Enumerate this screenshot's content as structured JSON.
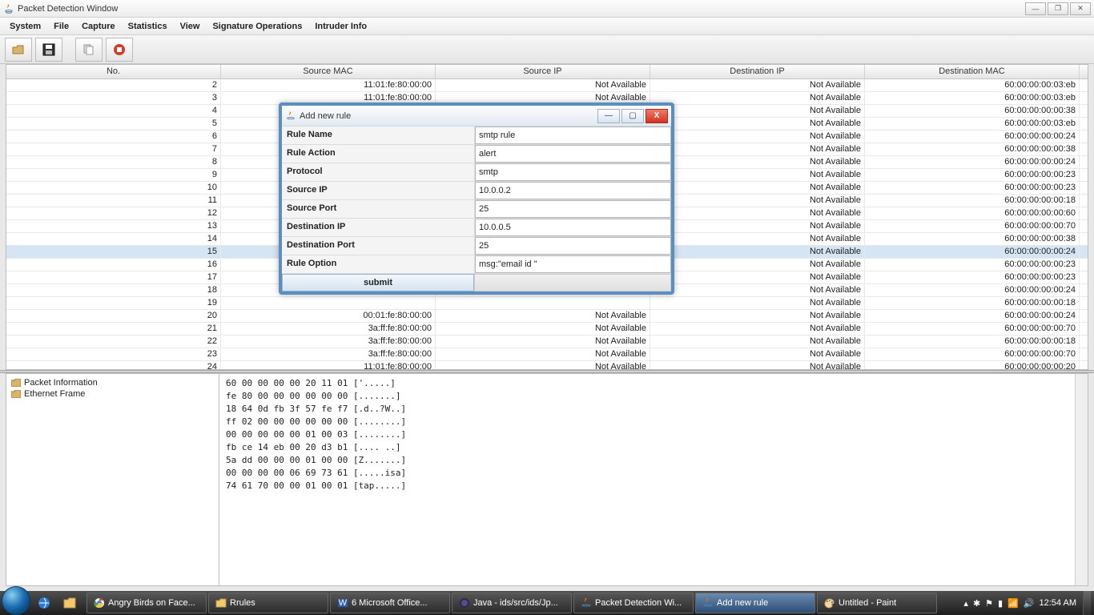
{
  "window": {
    "title": "Packet Detection Window"
  },
  "menu": [
    "System",
    "File",
    "Capture",
    "Statistics",
    "View",
    "Signature Operations",
    "Intruder Info"
  ],
  "columns": [
    "No.",
    "Source MAC",
    "Source IP",
    "Destination IP",
    "Destination MAC"
  ],
  "rows": [
    {
      "no": "2",
      "smac": "11:01:fe:80:00:00",
      "sip": "Not Available",
      "dip": "Not Available",
      "dmac": "60:00:00:00:03:eb"
    },
    {
      "no": "3",
      "smac": "11:01:fe:80:00:00",
      "sip": "Not Available",
      "dip": "Not Available",
      "dmac": "60:00:00:00:03:eb"
    },
    {
      "no": "4",
      "smac": "",
      "sip": "",
      "dip": "Not Available",
      "dmac": "60:00:00:00:00:38"
    },
    {
      "no": "5",
      "smac": "",
      "sip": "",
      "dip": "Not Available",
      "dmac": "60:00:00:00:03:eb"
    },
    {
      "no": "6",
      "smac": "",
      "sip": "",
      "dip": "Not Available",
      "dmac": "60:00:00:00:00:24"
    },
    {
      "no": "7",
      "smac": "",
      "sip": "",
      "dip": "Not Available",
      "dmac": "60:00:00:00:00:38"
    },
    {
      "no": "8",
      "smac": "",
      "sip": "",
      "dip": "Not Available",
      "dmac": "60:00:00:00:00:24"
    },
    {
      "no": "9",
      "smac": "",
      "sip": "",
      "dip": "Not Available",
      "dmac": "60:00:00:00:00:23"
    },
    {
      "no": "10",
      "smac": "",
      "sip": "",
      "dip": "Not Available",
      "dmac": "60:00:00:00:00:23"
    },
    {
      "no": "11",
      "smac": "",
      "sip": "",
      "dip": "Not Available",
      "dmac": "60:00:00:00:00:18"
    },
    {
      "no": "12",
      "smac": "",
      "sip": "",
      "dip": "Not Available",
      "dmac": "60:00:00:00:00:60"
    },
    {
      "no": "13",
      "smac": "",
      "sip": "",
      "dip": "Not Available",
      "dmac": "60:00:00:00:00:70"
    },
    {
      "no": "14",
      "smac": "",
      "sip": "",
      "dip": "Not Available",
      "dmac": "60:00:00:00:00:38"
    },
    {
      "no": "15",
      "smac": "",
      "sip": "",
      "dip": "Not Available",
      "dmac": "60:00:00:00:00:24",
      "selected": true
    },
    {
      "no": "16",
      "smac": "",
      "sip": "",
      "dip": "Not Available",
      "dmac": "60:00:00:00:00:23"
    },
    {
      "no": "17",
      "smac": "",
      "sip": "",
      "dip": "Not Available",
      "dmac": "60:00:00:00:00:23"
    },
    {
      "no": "18",
      "smac": "",
      "sip": "",
      "dip": "Not Available",
      "dmac": "60:00:00:00:00:24"
    },
    {
      "no": "19",
      "smac": "",
      "sip": "",
      "dip": "Not Available",
      "dmac": "60:00:00:00:00:18"
    },
    {
      "no": "20",
      "smac": "00:01:fe:80:00:00",
      "sip": "Not Available",
      "dip": "Not Available",
      "dmac": "60:00:00:00:00:24"
    },
    {
      "no": "21",
      "smac": "3a:ff:fe:80:00:00",
      "sip": "Not Available",
      "dip": "Not Available",
      "dmac": "60:00:00:00:00:70"
    },
    {
      "no": "22",
      "smac": "3a:ff:fe:80:00:00",
      "sip": "Not Available",
      "dip": "Not Available",
      "dmac": "60:00:00:00:00:18"
    },
    {
      "no": "23",
      "smac": "3a:ff:fe:80:00:00",
      "sip": "Not Available",
      "dip": "Not Available",
      "dmac": "60:00:00:00:00:70"
    },
    {
      "no": "24",
      "smac": "11:01:fe:80:00:00",
      "sip": "Not Available",
      "dip": "Not Available",
      "dmac": "60:00:00:00:00:20"
    }
  ],
  "tree": [
    "Packet Information",
    "Ethernet Frame"
  ],
  "hex": [
    "60 00 00 00 00 20 11 01 ['.....]",
    "fe 80 00 00 00 00 00 00 [.......]",
    "18 64 0d fb 3f 57 fe f7 [.d..?W..]",
    "ff 02 00 00 00 00 00 00 [........]",
    "00 00 00 00 00 01 00 03 [........]",
    "fb ce 14 eb 00 20 d3 b1 [.... ..]",
    "5a dd 00 00 00 01 00 00 [Z.......]",
    "00 00 00 00 06 69 73 61 [.....isa]",
    "74 61 70 00 00 01 00 01 [tap.....]"
  ],
  "dialog": {
    "title": "Add new rule",
    "fields": {
      "ruleName": {
        "label": "Rule Name",
        "value": "smtp rule"
      },
      "ruleAction": {
        "label": "Rule Action",
        "value": "alert"
      },
      "protocol": {
        "label": "Protocol",
        "value": "smtp"
      },
      "sourceIp": {
        "label": "Source IP",
        "value": "10.0.0.2"
      },
      "sourcePort": {
        "label": "Source Port",
        "value": "25"
      },
      "destIp": {
        "label": "Destination IP",
        "value": "10.0.0.5"
      },
      "destPort": {
        "label": "Destination Port",
        "value": "25"
      },
      "ruleOption": {
        "label": "Rule Option",
        "value": "msg:\"email id \""
      }
    },
    "submit": "submit"
  },
  "taskbar": {
    "items": [
      {
        "label": "Angry Birds on Face...",
        "icon": "chrome"
      },
      {
        "label": "Rrules",
        "icon": "folder"
      },
      {
        "label": "6 Microsoft Office...",
        "icon": "word",
        "badge": "6"
      },
      {
        "label": "Java - ids/src/ids/Jp...",
        "icon": "eclipse"
      },
      {
        "label": "Packet Detection Wi...",
        "icon": "java"
      },
      {
        "label": "Add new rule",
        "icon": "java",
        "active": true
      },
      {
        "label": "Untitled - Paint",
        "icon": "paint"
      }
    ],
    "time": "12:54 AM"
  }
}
